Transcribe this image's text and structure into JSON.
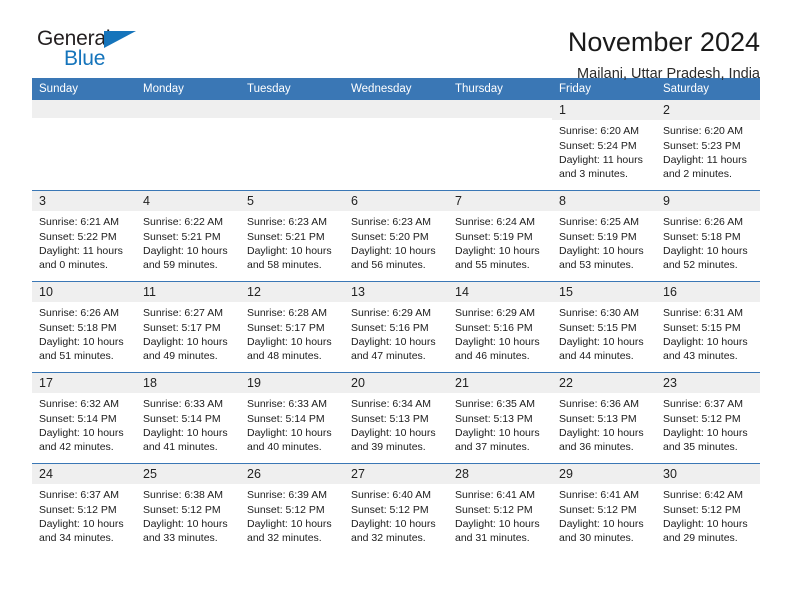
{
  "logo": {
    "word_one": "General",
    "word_two": "Blue",
    "triangle_color": "#1574bb"
  },
  "header": {
    "title": "November 2024",
    "subtitle": "Mailani, Uttar Pradesh, India"
  },
  "theme": {
    "header_blue": "#3a77b5",
    "daynum_band": "#efefef",
    "text": "#1c1c1c"
  },
  "weekdays": [
    "Sunday",
    "Monday",
    "Tuesday",
    "Wednesday",
    "Thursday",
    "Friday",
    "Saturday"
  ],
  "labels": {
    "sunrise_prefix": "Sunrise:",
    "sunset_prefix": "Sunset:",
    "daylight_prefix": "Daylight:"
  },
  "weeks": [
    [
      {
        "day": "",
        "empty": true
      },
      {
        "day": "",
        "empty": true
      },
      {
        "day": "",
        "empty": true
      },
      {
        "day": "",
        "empty": true
      },
      {
        "day": "",
        "empty": true
      },
      {
        "day": "1",
        "sunrise": "Sunrise: 6:20 AM",
        "sunset": "Sunset: 5:24 PM",
        "daylight": "Daylight: 11 hours and 3 minutes."
      },
      {
        "day": "2",
        "sunrise": "Sunrise: 6:20 AM",
        "sunset": "Sunset: 5:23 PM",
        "daylight": "Daylight: 11 hours and 2 minutes."
      }
    ],
    [
      {
        "day": "3",
        "sunrise": "Sunrise: 6:21 AM",
        "sunset": "Sunset: 5:22 PM",
        "daylight": "Daylight: 11 hours and 0 minutes."
      },
      {
        "day": "4",
        "sunrise": "Sunrise: 6:22 AM",
        "sunset": "Sunset: 5:21 PM",
        "daylight": "Daylight: 10 hours and 59 minutes."
      },
      {
        "day": "5",
        "sunrise": "Sunrise: 6:23 AM",
        "sunset": "Sunset: 5:21 PM",
        "daylight": "Daylight: 10 hours and 58 minutes."
      },
      {
        "day": "6",
        "sunrise": "Sunrise: 6:23 AM",
        "sunset": "Sunset: 5:20 PM",
        "daylight": "Daylight: 10 hours and 56 minutes."
      },
      {
        "day": "7",
        "sunrise": "Sunrise: 6:24 AM",
        "sunset": "Sunset: 5:19 PM",
        "daylight": "Daylight: 10 hours and 55 minutes."
      },
      {
        "day": "8",
        "sunrise": "Sunrise: 6:25 AM",
        "sunset": "Sunset: 5:19 PM",
        "daylight": "Daylight: 10 hours and 53 minutes."
      },
      {
        "day": "9",
        "sunrise": "Sunrise: 6:26 AM",
        "sunset": "Sunset: 5:18 PM",
        "daylight": "Daylight: 10 hours and 52 minutes."
      }
    ],
    [
      {
        "day": "10",
        "sunrise": "Sunrise: 6:26 AM",
        "sunset": "Sunset: 5:18 PM",
        "daylight": "Daylight: 10 hours and 51 minutes."
      },
      {
        "day": "11",
        "sunrise": "Sunrise: 6:27 AM",
        "sunset": "Sunset: 5:17 PM",
        "daylight": "Daylight: 10 hours and 49 minutes."
      },
      {
        "day": "12",
        "sunrise": "Sunrise: 6:28 AM",
        "sunset": "Sunset: 5:17 PM",
        "daylight": "Daylight: 10 hours and 48 minutes."
      },
      {
        "day": "13",
        "sunrise": "Sunrise: 6:29 AM",
        "sunset": "Sunset: 5:16 PM",
        "daylight": "Daylight: 10 hours and 47 minutes."
      },
      {
        "day": "14",
        "sunrise": "Sunrise: 6:29 AM",
        "sunset": "Sunset: 5:16 PM",
        "daylight": "Daylight: 10 hours and 46 minutes."
      },
      {
        "day": "15",
        "sunrise": "Sunrise: 6:30 AM",
        "sunset": "Sunset: 5:15 PM",
        "daylight": "Daylight: 10 hours and 44 minutes."
      },
      {
        "day": "16",
        "sunrise": "Sunrise: 6:31 AM",
        "sunset": "Sunset: 5:15 PM",
        "daylight": "Daylight: 10 hours and 43 minutes."
      }
    ],
    [
      {
        "day": "17",
        "sunrise": "Sunrise: 6:32 AM",
        "sunset": "Sunset: 5:14 PM",
        "daylight": "Daylight: 10 hours and 42 minutes."
      },
      {
        "day": "18",
        "sunrise": "Sunrise: 6:33 AM",
        "sunset": "Sunset: 5:14 PM",
        "daylight": "Daylight: 10 hours and 41 minutes."
      },
      {
        "day": "19",
        "sunrise": "Sunrise: 6:33 AM",
        "sunset": "Sunset: 5:14 PM",
        "daylight": "Daylight: 10 hours and 40 minutes."
      },
      {
        "day": "20",
        "sunrise": "Sunrise: 6:34 AM",
        "sunset": "Sunset: 5:13 PM",
        "daylight": "Daylight: 10 hours and 39 minutes."
      },
      {
        "day": "21",
        "sunrise": "Sunrise: 6:35 AM",
        "sunset": "Sunset: 5:13 PM",
        "daylight": "Daylight: 10 hours and 37 minutes."
      },
      {
        "day": "22",
        "sunrise": "Sunrise: 6:36 AM",
        "sunset": "Sunset: 5:13 PM",
        "daylight": "Daylight: 10 hours and 36 minutes."
      },
      {
        "day": "23",
        "sunrise": "Sunrise: 6:37 AM",
        "sunset": "Sunset: 5:12 PM",
        "daylight": "Daylight: 10 hours and 35 minutes."
      }
    ],
    [
      {
        "day": "24",
        "sunrise": "Sunrise: 6:37 AM",
        "sunset": "Sunset: 5:12 PM",
        "daylight": "Daylight: 10 hours and 34 minutes."
      },
      {
        "day": "25",
        "sunrise": "Sunrise: 6:38 AM",
        "sunset": "Sunset: 5:12 PM",
        "daylight": "Daylight: 10 hours and 33 minutes."
      },
      {
        "day": "26",
        "sunrise": "Sunrise: 6:39 AM",
        "sunset": "Sunset: 5:12 PM",
        "daylight": "Daylight: 10 hours and 32 minutes."
      },
      {
        "day": "27",
        "sunrise": "Sunrise: 6:40 AM",
        "sunset": "Sunset: 5:12 PM",
        "daylight": "Daylight: 10 hours and 32 minutes."
      },
      {
        "day": "28",
        "sunrise": "Sunrise: 6:41 AM",
        "sunset": "Sunset: 5:12 PM",
        "daylight": "Daylight: 10 hours and 31 minutes."
      },
      {
        "day": "29",
        "sunrise": "Sunrise: 6:41 AM",
        "sunset": "Sunset: 5:12 PM",
        "daylight": "Daylight: 10 hours and 30 minutes."
      },
      {
        "day": "30",
        "sunrise": "Sunrise: 6:42 AM",
        "sunset": "Sunset: 5:12 PM",
        "daylight": "Daylight: 10 hours and 29 minutes."
      }
    ]
  ]
}
